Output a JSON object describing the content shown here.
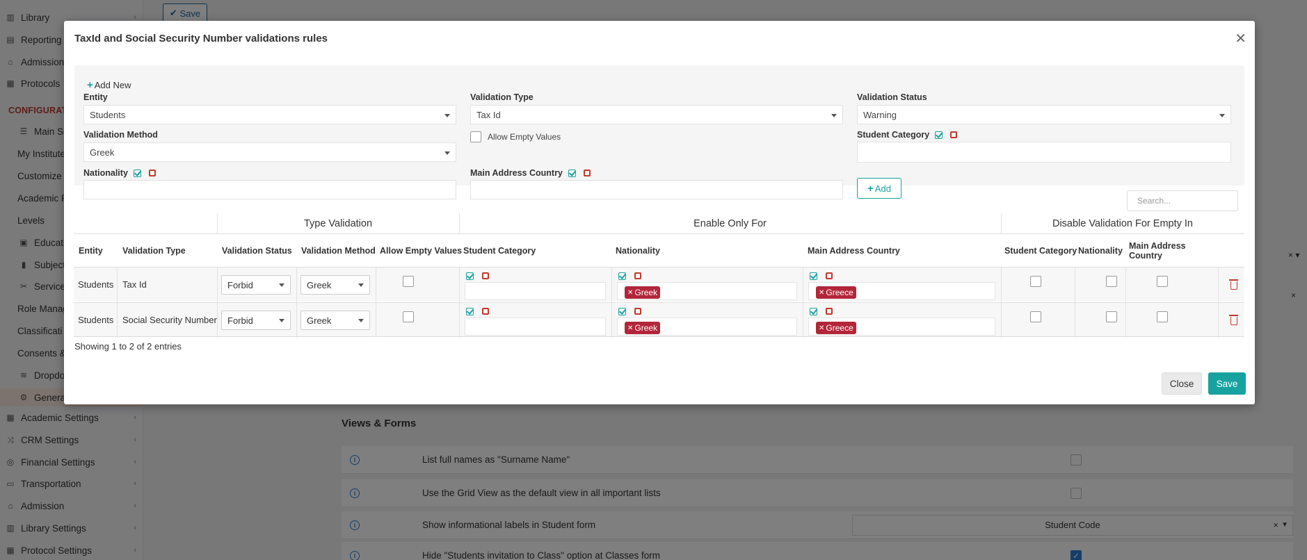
{
  "background": {
    "sidebar": {
      "items_top": [
        {
          "label": "Library",
          "icon": "books-icon"
        },
        {
          "label": "Reporting",
          "icon": "printer-icon"
        },
        {
          "label": "Admission",
          "icon": "bank-icon"
        },
        {
          "label": "Protocols",
          "icon": "binder-icon"
        }
      ],
      "heading": "CONFIGURATI",
      "main_settings": "Main Setti",
      "sub_items": [
        "My Institute",
        "Customize T",
        "Academic P",
        "Levels",
        "Educatio",
        "Subjects",
        "Services",
        "Role Manag",
        "Classificati",
        "Consents &",
        "Dropdow",
        "General"
      ],
      "items_bottom": [
        {
          "label": "Academic Settings",
          "icon": "grid-icon"
        },
        {
          "label": "CRM Settings",
          "icon": "shuffle-icon"
        },
        {
          "label": "Financial Settings",
          "icon": "coins-icon"
        },
        {
          "label": "Transportation",
          "icon": "bus-icon"
        },
        {
          "label": "Admission",
          "icon": "bank-icon"
        },
        {
          "label": "Library Settings",
          "icon": "books-icon"
        },
        {
          "label": "Protocol Settings",
          "icon": "binder-icon"
        }
      ]
    },
    "save_label": "Save",
    "section_title": "Views & Forms",
    "settings_rows": [
      {
        "text": "List full names as \"Surname Name\"",
        "type": "checkbox",
        "checked": false
      },
      {
        "text": "Use the Grid View as the default view in all important lists",
        "type": "checkbox",
        "checked": false
      },
      {
        "text": "Show informational labels in Student form",
        "type": "select",
        "value": "Student Code"
      },
      {
        "text": "Hide \"Students invitation to Class\" option at Classes form",
        "type": "checkbox",
        "checked": true
      }
    ]
  },
  "modal": {
    "title": "TaxId and Social Security Number validations rules",
    "close_icon": "close-icon",
    "form": {
      "add_new_label": "Add New",
      "entity": {
        "label": "Entity",
        "value": "Students"
      },
      "validation_type": {
        "label": "Validation Type",
        "value": "Tax Id"
      },
      "validation_status": {
        "label": "Validation Status",
        "value": "Warning"
      },
      "validation_method": {
        "label": "Validation Method",
        "value": "Greek"
      },
      "allow_empty_label": "Allow Empty Values",
      "student_category_label": "Student Category",
      "nationality_label": "Nationality",
      "main_address_country_label": "Main Address Country",
      "add_button": "Add"
    },
    "search_placeholder": "Search...",
    "table": {
      "groups": [
        "Type Validation",
        "Enable Only For",
        "Disable Validation For Empty In"
      ],
      "headers": [
        "Entity",
        "Validation Type",
        "Validation Status",
        "Validation Method",
        "Allow Empty Values",
        "Student Category",
        "Nationality",
        "Main Address Country",
        "Student Category",
        "Nationality",
        "Main Address Country"
      ],
      "rows": [
        {
          "entity": "Students",
          "validation_type": "Tax Id",
          "status": "Forbid",
          "method": "Greek",
          "nationality_tag": "Greek",
          "country_tag": "Greece"
        },
        {
          "entity": "Students",
          "validation_type": "Social Security Number",
          "status": "Forbid",
          "method": "Greek",
          "nationality_tag": "Greek",
          "country_tag": "Greece"
        }
      ]
    },
    "showing_text": "Showing 1 to 2 of 2 entries",
    "close_button": "Close",
    "save_button": "Save"
  },
  "colors": {
    "accent": "#17a2a0",
    "danger": "#c0392b",
    "tag": "#b3263a",
    "heading": "#c0392b"
  }
}
